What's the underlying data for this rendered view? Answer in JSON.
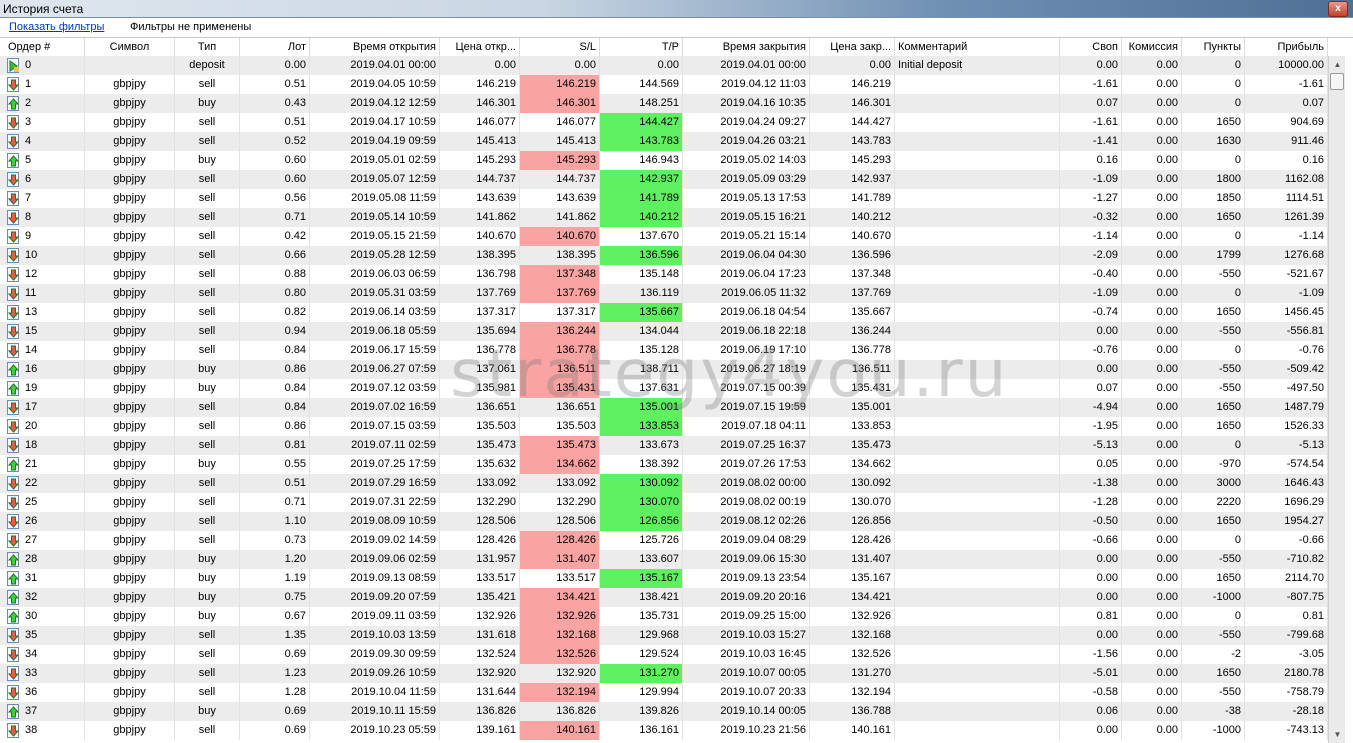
{
  "window": {
    "title": "История счета",
    "close_label": "x"
  },
  "filters": {
    "show_link": "Показать фильтры",
    "status": "Фильтры не применены"
  },
  "watermark": "strategy4you.ru",
  "columns": [
    "Ордер #",
    "Символ",
    "Тип",
    "Лот",
    "Время открытия",
    "Цена откр...",
    "S/L",
    "T/P",
    "Время закрытия",
    "Цена закр...",
    "Комментарий",
    "Своп",
    "Комиссия",
    "Пункты",
    "Прибыль"
  ],
  "colors": {
    "sl_hit": "#f9a3a3",
    "tp_hit": "#5ef05e"
  },
  "rows": [
    [
      "0",
      "",
      "deposit",
      "0.00",
      "2019.04.01 00:00",
      "0.00",
      "0.00",
      "0.00",
      "2019.04.01 00:00",
      "0.00",
      "Initial deposit",
      "0.00",
      "0.00",
      "0",
      "10000.00",
      ""
    ],
    [
      "1",
      "gbpjpy",
      "sell",
      "0.51",
      "2019.04.05 10:59",
      "146.219",
      "146.219",
      "144.569",
      "2019.04.12 11:03",
      "146.219",
      "",
      "-1.61",
      "0.00",
      "0",
      "-1.61",
      "sl"
    ],
    [
      "2",
      "gbpjpy",
      "buy",
      "0.43",
      "2019.04.12 12:59",
      "146.301",
      "146.301",
      "148.251",
      "2019.04.16 10:35",
      "146.301",
      "",
      "0.07",
      "0.00",
      "0",
      "0.07",
      "sl"
    ],
    [
      "3",
      "gbpjpy",
      "sell",
      "0.51",
      "2019.04.17 10:59",
      "146.077",
      "146.077",
      "144.427",
      "2019.04.24 09:27",
      "144.427",
      "",
      "-1.61",
      "0.00",
      "1650",
      "904.69",
      "tp"
    ],
    [
      "4",
      "gbpjpy",
      "sell",
      "0.52",
      "2019.04.19 09:59",
      "145.413",
      "145.413",
      "143.783",
      "2019.04.26 03:21",
      "143.783",
      "",
      "-1.41",
      "0.00",
      "1630",
      "911.46",
      "tp"
    ],
    [
      "5",
      "gbpjpy",
      "buy",
      "0.60",
      "2019.05.01 02:59",
      "145.293",
      "145.293",
      "146.943",
      "2019.05.02 14:03",
      "145.293",
      "",
      "0.16",
      "0.00",
      "0",
      "0.16",
      "sl"
    ],
    [
      "6",
      "gbpjpy",
      "sell",
      "0.60",
      "2019.05.07 12:59",
      "144.737",
      "144.737",
      "142.937",
      "2019.05.09 03:29",
      "142.937",
      "",
      "-1.09",
      "0.00",
      "1800",
      "1162.08",
      "tp"
    ],
    [
      "7",
      "gbpjpy",
      "sell",
      "0.56",
      "2019.05.08 11:59",
      "143.639",
      "143.639",
      "141.789",
      "2019.05.13 17:53",
      "141.789",
      "",
      "-1.27",
      "0.00",
      "1850",
      "1114.51",
      "tp"
    ],
    [
      "8",
      "gbpjpy",
      "sell",
      "0.71",
      "2019.05.14 10:59",
      "141.862",
      "141.862",
      "140.212",
      "2019.05.15 16:21",
      "140.212",
      "",
      "-0.32",
      "0.00",
      "1650",
      "1261.39",
      "tp"
    ],
    [
      "9",
      "gbpjpy",
      "sell",
      "0.42",
      "2019.05.15 21:59",
      "140.670",
      "140.670",
      "137.670",
      "2019.05.21 15:14",
      "140.670",
      "",
      "-1.14",
      "0.00",
      "0",
      "-1.14",
      "sl"
    ],
    [
      "10",
      "gbpjpy",
      "sell",
      "0.66",
      "2019.05.28 12:59",
      "138.395",
      "138.395",
      "136.596",
      "2019.06.04 04:30",
      "136.596",
      "",
      "-2.09",
      "0.00",
      "1799",
      "1276.68",
      "tp"
    ],
    [
      "12",
      "gbpjpy",
      "sell",
      "0.88",
      "2019.06.03 06:59",
      "136.798",
      "137.348",
      "135.148",
      "2019.06.04 17:23",
      "137.348",
      "",
      "-0.40",
      "0.00",
      "-550",
      "-521.67",
      "sl"
    ],
    [
      "11",
      "gbpjpy",
      "sell",
      "0.80",
      "2019.05.31 03:59",
      "137.769",
      "137.769",
      "136.119",
      "2019.06.05 11:32",
      "137.769",
      "",
      "-1.09",
      "0.00",
      "0",
      "-1.09",
      "sl"
    ],
    [
      "13",
      "gbpjpy",
      "sell",
      "0.82",
      "2019.06.14 03:59",
      "137.317",
      "137.317",
      "135.667",
      "2019.06.18 04:54",
      "135.667",
      "",
      "-0.74",
      "0.00",
      "1650",
      "1456.45",
      "tp"
    ],
    [
      "15",
      "gbpjpy",
      "sell",
      "0.94",
      "2019.06.18 05:59",
      "135.694",
      "136.244",
      "134.044",
      "2019.06.18 22:18",
      "136.244",
      "",
      "0.00",
      "0.00",
      "-550",
      "-556.81",
      "sl"
    ],
    [
      "14",
      "gbpjpy",
      "sell",
      "0.84",
      "2019.06.17 15:59",
      "136.778",
      "136.778",
      "135.128",
      "2019.06.19 17:10",
      "136.778",
      "",
      "-0.76",
      "0.00",
      "0",
      "-0.76",
      "sl"
    ],
    [
      "16",
      "gbpjpy",
      "buy",
      "0.86",
      "2019.06.27 07:59",
      "137.061",
      "136.511",
      "138.711",
      "2019.06.27 18:19",
      "136.511",
      "",
      "0.00",
      "0.00",
      "-550",
      "-509.42",
      "sl"
    ],
    [
      "19",
      "gbpjpy",
      "buy",
      "0.84",
      "2019.07.12 03:59",
      "135.981",
      "135.431",
      "137.631",
      "2019.07.15 00:39",
      "135.431",
      "",
      "0.07",
      "0.00",
      "-550",
      "-497.50",
      "sl"
    ],
    [
      "17",
      "gbpjpy",
      "sell",
      "0.84",
      "2019.07.02 16:59",
      "136.651",
      "136.651",
      "135.001",
      "2019.07.15 19:59",
      "135.001",
      "",
      "-4.94",
      "0.00",
      "1650",
      "1487.79",
      "tp"
    ],
    [
      "20",
      "gbpjpy",
      "sell",
      "0.86",
      "2019.07.15 03:59",
      "135.503",
      "135.503",
      "133.853",
      "2019.07.18 04:11",
      "133.853",
      "",
      "-1.95",
      "0.00",
      "1650",
      "1526.33",
      "tp"
    ],
    [
      "18",
      "gbpjpy",
      "sell",
      "0.81",
      "2019.07.11 02:59",
      "135.473",
      "135.473",
      "133.673",
      "2019.07.25 16:37",
      "135.473",
      "",
      "-5.13",
      "0.00",
      "0",
      "-5.13",
      "sl"
    ],
    [
      "21",
      "gbpjpy",
      "buy",
      "0.55",
      "2019.07.25 17:59",
      "135.632",
      "134.662",
      "138.392",
      "2019.07.26 17:53",
      "134.662",
      "",
      "0.05",
      "0.00",
      "-970",
      "-574.54",
      "sl"
    ],
    [
      "22",
      "gbpjpy",
      "sell",
      "0.51",
      "2019.07.29 16:59",
      "133.092",
      "133.092",
      "130.092",
      "2019.08.02 00:00",
      "130.092",
      "",
      "-1.38",
      "0.00",
      "3000",
      "1646.43",
      "tp"
    ],
    [
      "25",
      "gbpjpy",
      "sell",
      "0.71",
      "2019.07.31 22:59",
      "132.290",
      "132.290",
      "130.070",
      "2019.08.02 00:19",
      "130.070",
      "",
      "-1.28",
      "0.00",
      "2220",
      "1696.29",
      "tp"
    ],
    [
      "26",
      "gbpjpy",
      "sell",
      "1.10",
      "2019.08.09 10:59",
      "128.506",
      "128.506",
      "126.856",
      "2019.08.12 02:26",
      "126.856",
      "",
      "-0.50",
      "0.00",
      "1650",
      "1954.27",
      "tp"
    ],
    [
      "27",
      "gbpjpy",
      "sell",
      "0.73",
      "2019.09.02 14:59",
      "128.426",
      "128.426",
      "125.726",
      "2019.09.04 08:29",
      "128.426",
      "",
      "-0.66",
      "0.00",
      "0",
      "-0.66",
      "sl"
    ],
    [
      "28",
      "gbpjpy",
      "buy",
      "1.20",
      "2019.09.06 02:59",
      "131.957",
      "131.407",
      "133.607",
      "2019.09.06 15:30",
      "131.407",
      "",
      "0.00",
      "0.00",
      "-550",
      "-710.82",
      "sl"
    ],
    [
      "31",
      "gbpjpy",
      "buy",
      "1.19",
      "2019.09.13 08:59",
      "133.517",
      "133.517",
      "135.167",
      "2019.09.13 23:54",
      "135.167",
      "",
      "0.00",
      "0.00",
      "1650",
      "2114.70",
      "tp"
    ],
    [
      "32",
      "gbpjpy",
      "buy",
      "0.75",
      "2019.09.20 07:59",
      "135.421",
      "134.421",
      "138.421",
      "2019.09.20 20:16",
      "134.421",
      "",
      "0.00",
      "0.00",
      "-1000",
      "-807.75",
      "sl"
    ],
    [
      "30",
      "gbpjpy",
      "buy",
      "0.67",
      "2019.09.11 03:59",
      "132.926",
      "132.926",
      "135.731",
      "2019.09.25 15:00",
      "132.926",
      "",
      "0.81",
      "0.00",
      "0",
      "0.81",
      "sl"
    ],
    [
      "35",
      "gbpjpy",
      "sell",
      "1.35",
      "2019.10.03 13:59",
      "131.618",
      "132.168",
      "129.968",
      "2019.10.03 15:27",
      "132.168",
      "",
      "0.00",
      "0.00",
      "-550",
      "-799.68",
      "sl"
    ],
    [
      "34",
      "gbpjpy",
      "sell",
      "0.69",
      "2019.09.30 09:59",
      "132.524",
      "132.526",
      "129.524",
      "2019.10.03 16:45",
      "132.526",
      "",
      "-1.56",
      "0.00",
      "-2",
      "-3.05",
      "sl"
    ],
    [
      "33",
      "gbpjpy",
      "sell",
      "1.23",
      "2019.09.26 10:59",
      "132.920",
      "132.920",
      "131.270",
      "2019.10.07 00:05",
      "131.270",
      "",
      "-5.01",
      "0.00",
      "1650",
      "2180.78",
      "tp"
    ],
    [
      "36",
      "gbpjpy",
      "sell",
      "1.28",
      "2019.10.04 11:59",
      "131.644",
      "132.194",
      "129.994",
      "2019.10.07 20:33",
      "132.194",
      "",
      "-0.58",
      "0.00",
      "-550",
      "-758.79",
      "sl"
    ],
    [
      "37",
      "gbpjpy",
      "buy",
      "0.69",
      "2019.10.11 15:59",
      "136.826",
      "136.826",
      "139.826",
      "2019.10.14 00:05",
      "136.788",
      "",
      "0.06",
      "0.00",
      "-38",
      "-28.18",
      ""
    ],
    [
      "38",
      "gbpjpy",
      "sell",
      "0.69",
      "2019.10.23 05:59",
      "139.161",
      "140.161",
      "136.161",
      "2019.10.23 21:56",
      "140.161",
      "",
      "0.00",
      "0.00",
      "-1000",
      "-743.13",
      "sl"
    ]
  ]
}
